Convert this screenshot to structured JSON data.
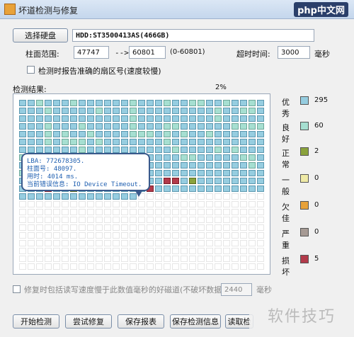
{
  "window": {
    "title": "坏道检测与修复",
    "watermark": "php中文网"
  },
  "disk": {
    "select_label": "选择硬盘",
    "name": "HDD:ST3500413AS(466GB)"
  },
  "cylinder": {
    "label": "柱面范围:",
    "from": "47747",
    "arrow": "-->",
    "to": "60801",
    "range": "(0-60801)"
  },
  "timeout": {
    "label": "超时时间:",
    "value": "3000",
    "unit": "毫秒"
  },
  "report_sector": {
    "label": "检测时报告准确的扇区号(速度较慢)"
  },
  "result": {
    "label": "检测结果:",
    "progress": "2%"
  },
  "legend": [
    {
      "label": "优秀",
      "count": "295",
      "color": "#96cde0"
    },
    {
      "label": "良好",
      "count": "60",
      "color": "#a6dfd1"
    },
    {
      "label": "正常",
      "count": "2",
      "color": "#8aa23c"
    },
    {
      "label": "一般",
      "count": "0",
      "color": "#efeaa6"
    },
    {
      "label": "欠佳",
      "count": "0",
      "color": "#e8a23a"
    },
    {
      "label": "严重",
      "count": "0",
      "color": "#a69a94"
    },
    {
      "label": "损坏",
      "count": "5",
      "color": "#b23a4a"
    }
  ],
  "tooltip": {
    "lba": "LBA: 772678305.",
    "cylinder": "柱面号: 48097.",
    "time": "用时: 4014 ms.",
    "error": "当前错误信息: IO Device Timeout."
  },
  "repair_option": {
    "label": "修复时包括读写速度慢于此数值毫秒的好磁道(不破坏数据)",
    "value": "2440",
    "unit": "毫秒"
  },
  "buttons": {
    "start": "开始检测",
    "repair": "尝试修复",
    "save_report": "保存报表",
    "save_info": "保存检测信息",
    "read": "读取检"
  },
  "watermark_bottom": "软件技巧"
}
